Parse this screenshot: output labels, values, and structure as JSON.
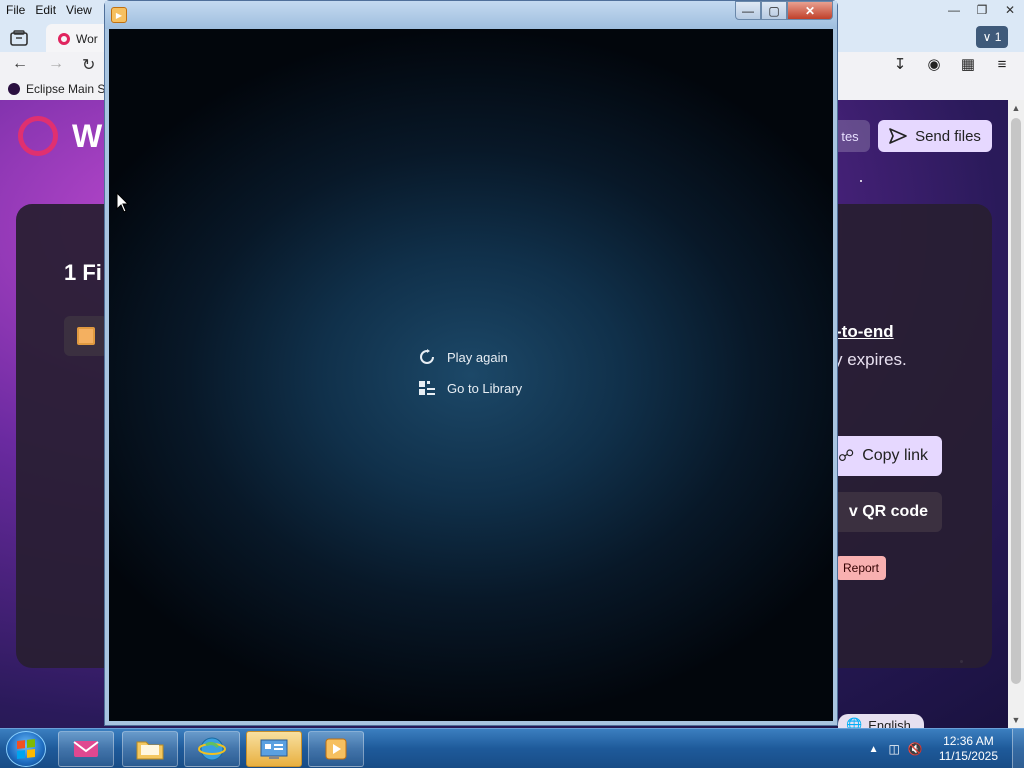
{
  "browser": {
    "menu": [
      "File",
      "Edit",
      "View"
    ],
    "tab_title": "Wor",
    "tabs_count": "1",
    "bookmark": "Eclipse Main S",
    "page": {
      "brand": "W",
      "ghost_button": "tes",
      "send_button": "Send files",
      "files_title": "1 Fi",
      "e2e_text": "-to-end",
      "expires_text": "y expires.",
      "copy_link": "Copy link",
      "qr_code": "v QR code",
      "report": "Report",
      "language": "English"
    }
  },
  "player": {
    "menu_items": [
      {
        "label": "Play again",
        "icon": "replay-icon"
      },
      {
        "label": "Go to Library",
        "icon": "library-icon"
      }
    ]
  },
  "taskbar": {
    "time": "12:36 AM",
    "date": "11/15/2025"
  },
  "colors": {
    "player_close": "#c0402a",
    "accent_button": "#e6d8ff",
    "taskbar": "#1e5a9a"
  }
}
